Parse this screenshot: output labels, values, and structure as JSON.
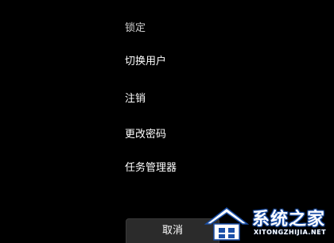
{
  "menu": {
    "items": [
      {
        "label": "锁定"
      },
      {
        "label": "切换用户"
      },
      {
        "label": "注销"
      },
      {
        "label": "更改密码"
      },
      {
        "label": "任务管理器"
      }
    ]
  },
  "cancel": {
    "label": "取消"
  },
  "watermark": {
    "title": "系统之家",
    "url": "XITONGZHIJIA.NET",
    "accent_color": "#1a4fa8"
  }
}
